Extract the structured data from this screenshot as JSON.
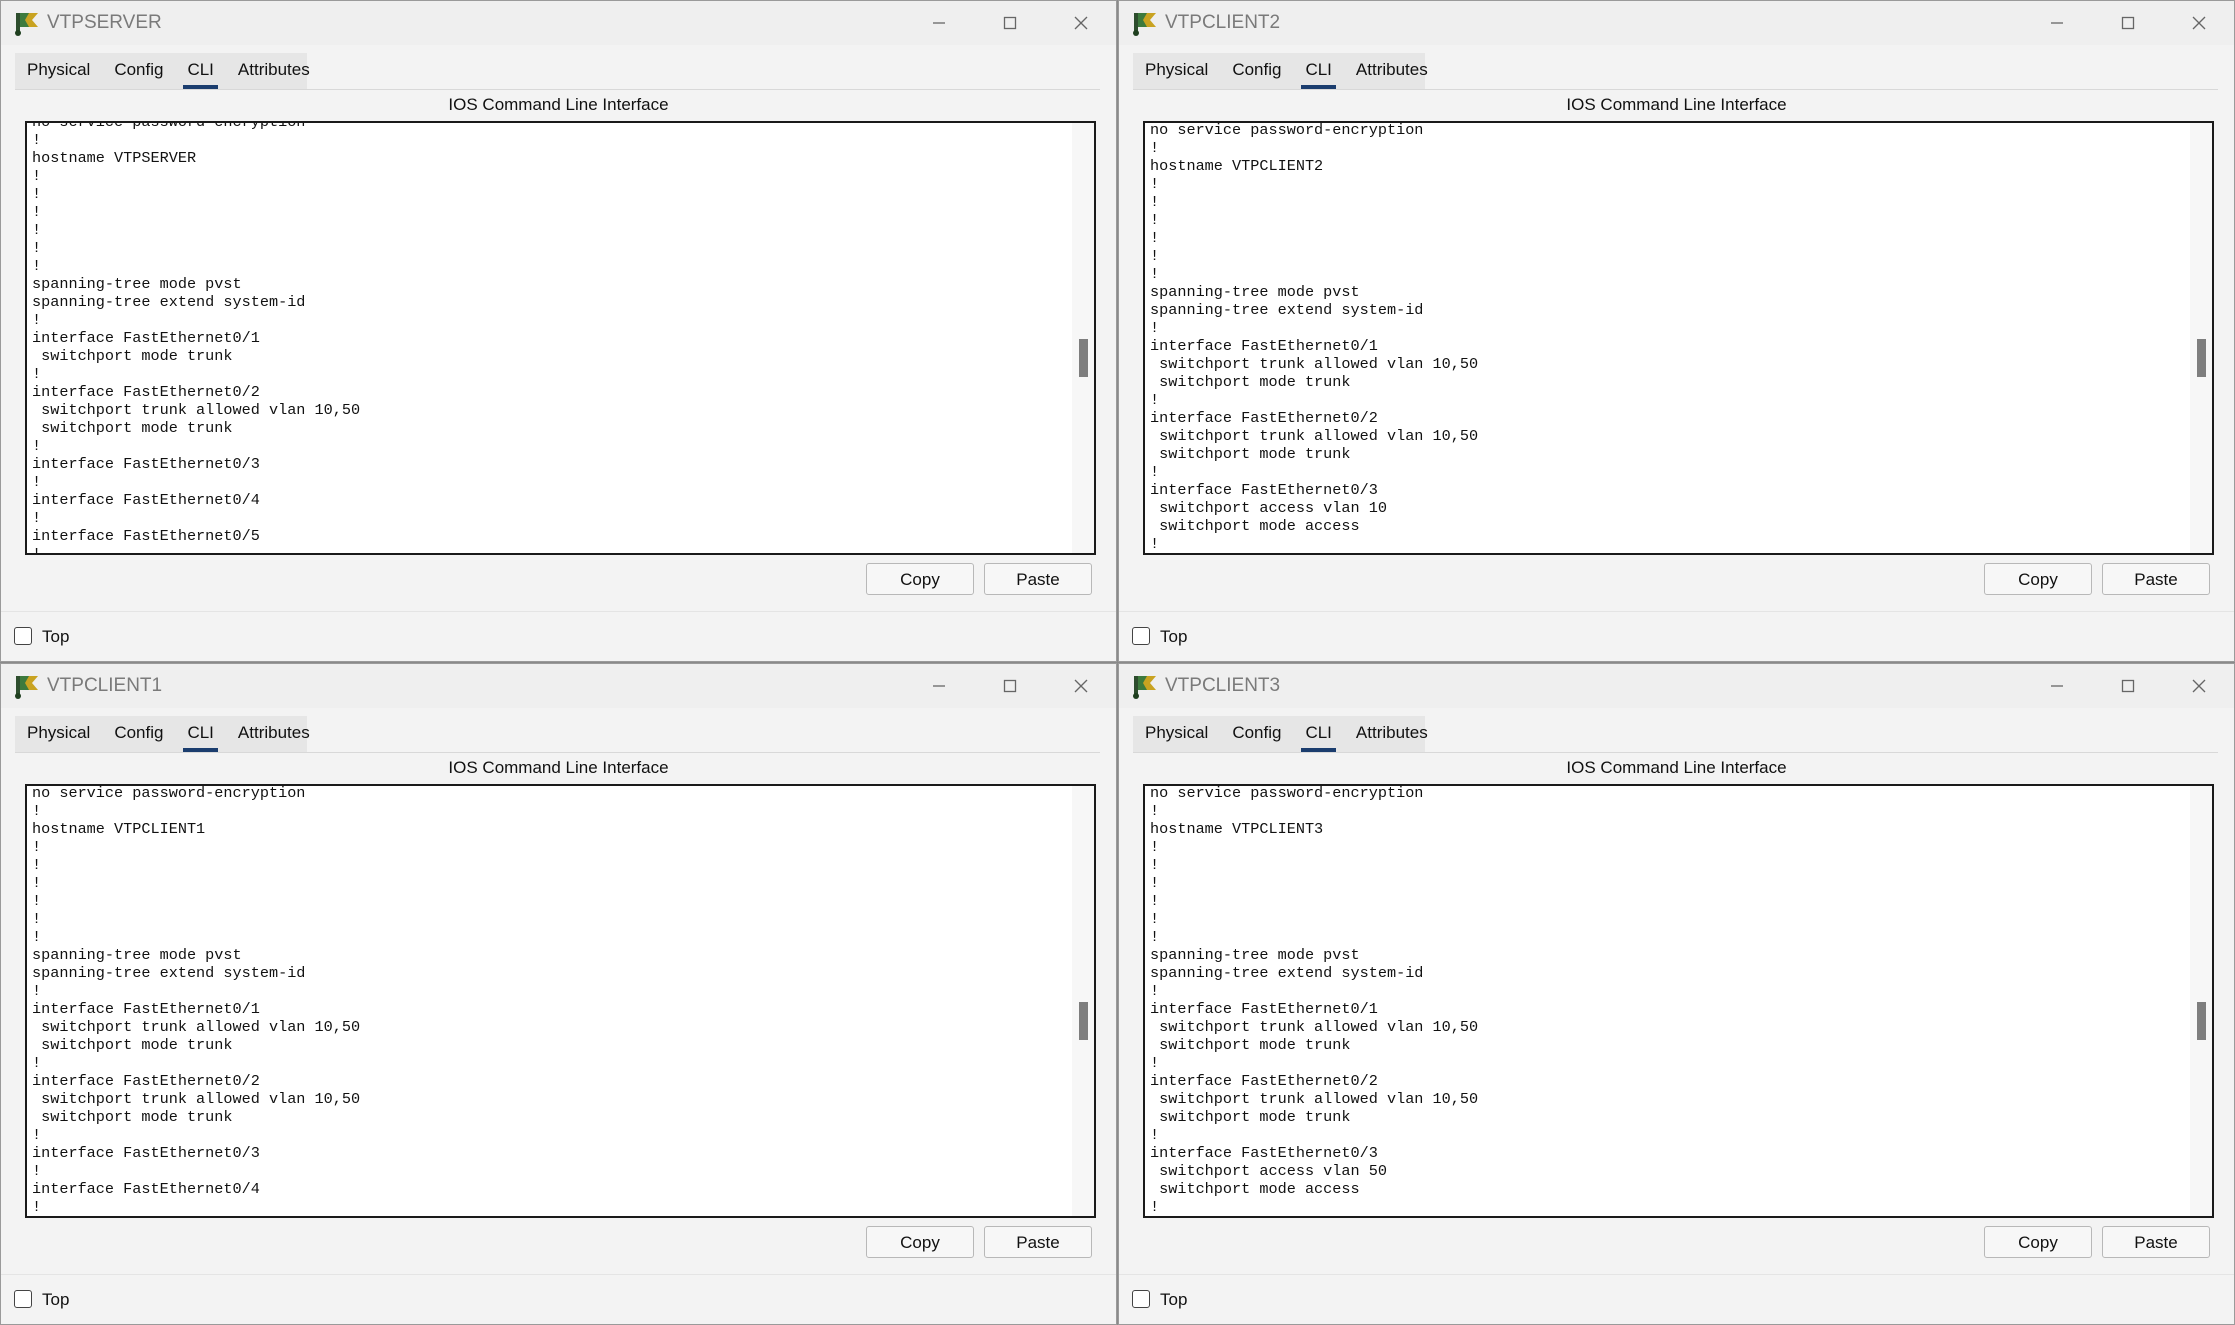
{
  "common": {
    "tabs": [
      "Physical",
      "Config",
      "CLI",
      "Attributes"
    ],
    "active_tab": "CLI",
    "cli_heading": "IOS Command Line Interface",
    "copy_label": "Copy",
    "paste_label": "Paste",
    "top_label": "Top",
    "window_controls": [
      "minimize-icon",
      "maximize-icon",
      "close-icon"
    ]
  },
  "windows": [
    {
      "title": "VTPSERVER",
      "scroll_fraction": 0.55,
      "cli_lines": [
        "no service password-encryption",
        "!",
        "hostname VTPSERVER",
        "!",
        "!",
        "!",
        "!",
        "!",
        "!",
        "spanning-tree mode pvst",
        "spanning-tree extend system-id",
        "!",
        "interface FastEthernet0/1",
        " switchport mode trunk",
        "!",
        "interface FastEthernet0/2",
        " switchport trunk allowed vlan 10,50",
        " switchport mode trunk",
        "!",
        "interface FastEthernet0/3",
        "!",
        "interface FastEthernet0/4",
        "!",
        "interface FastEthernet0/5",
        "!"
      ]
    },
    {
      "title": "VTPCLIENT2",
      "scroll_fraction": 0.55,
      "cli_lines": [
        "no service password-encryption",
        "!",
        "hostname VTPCLIENT2",
        "!",
        "!",
        "!",
        "!",
        "!",
        "!",
        "spanning-tree mode pvst",
        "spanning-tree extend system-id",
        "!",
        "interface FastEthernet0/1",
        " switchport trunk allowed vlan 10,50",
        " switchport mode trunk",
        "!",
        "interface FastEthernet0/2",
        " switchport trunk allowed vlan 10,50",
        " switchport mode trunk",
        "!",
        "interface FastEthernet0/3",
        " switchport access vlan 10",
        " switchport mode access",
        "!"
      ]
    },
    {
      "title": "VTPCLIENT1",
      "scroll_fraction": 0.55,
      "cli_lines": [
        "no service password-encryption",
        "!",
        "hostname VTPCLIENT1",
        "!",
        "!",
        "!",
        "!",
        "!",
        "!",
        "spanning-tree mode pvst",
        "spanning-tree extend system-id",
        "!",
        "interface FastEthernet0/1",
        " switchport trunk allowed vlan 10,50",
        " switchport mode trunk",
        "!",
        "interface FastEthernet0/2",
        " switchport trunk allowed vlan 10,50",
        " switchport mode trunk",
        "!",
        "interface FastEthernet0/3",
        "!",
        "interface FastEthernet0/4",
        "!"
      ]
    },
    {
      "title": "VTPCLIENT3",
      "scroll_fraction": 0.55,
      "cli_lines": [
        "no service password-encryption",
        "!",
        "hostname VTPCLIENT3",
        "!",
        "!",
        "!",
        "!",
        "!",
        "!",
        "spanning-tree mode pvst",
        "spanning-tree extend system-id",
        "!",
        "interface FastEthernet0/1",
        " switchport trunk allowed vlan 10,50",
        " switchport mode trunk",
        "!",
        "interface FastEthernet0/2",
        " switchport trunk allowed vlan 10,50",
        " switchport mode trunk",
        "!",
        "interface FastEthernet0/3",
        " switchport access vlan 50",
        " switchport mode access",
        "!"
      ]
    }
  ]
}
